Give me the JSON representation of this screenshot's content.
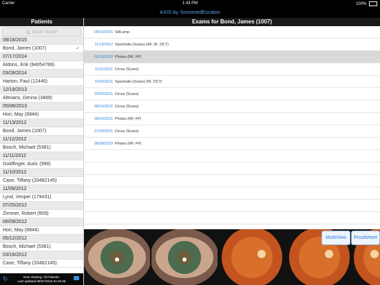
{
  "status_bar": {
    "carrier": "Carrier",
    "time": "1:43 PM",
    "battery": "100%"
  },
  "app": {
    "title": "AXIS by SonomedEscalon"
  },
  "patients_pane": {
    "title": "Patients",
    "search_placeholder": "Smart Search",
    "rows": [
      {
        "date": "09/16/2015",
        "name": "Bond, James (1007)",
        "selected": true
      },
      {
        "date": "07/17/2014",
        "name": "Aldons, Erik (94054789)"
      },
      {
        "date": "03/28/2014",
        "name": "Harton, Paul (12446)"
      },
      {
        "date": "12/19/2013",
        "name": "Altmans, Denna (3489)"
      },
      {
        "date": "05/06/2013",
        "name": "Hori, May (6844)"
      },
      {
        "date": "11/13/2012",
        "name": "Bond, James (1007)"
      },
      {
        "date": "11/12/2012",
        "name": "Bosch, Michael (5381)"
      },
      {
        "date": "11/11/2012",
        "name": "Goldfinger, Auric (998)"
      },
      {
        "date": "11/10/2012",
        "name": "Case, Tiffany (33482145)"
      },
      {
        "date": "11/09/2012",
        "name": "Lynd, Vesper (179431)"
      },
      {
        "date": "07/25/2012",
        "name": "Zimmer, Robert (609)"
      },
      {
        "date": "06/09/2012",
        "name": "Hori, May (6844)"
      },
      {
        "date": "05/12/2012",
        "name": "Bosch, Michael (5381)"
      },
      {
        "date": "03/16/2012",
        "name": "Case, Tiffany (33482145)"
      }
    ],
    "footer_line1": "Now Viewing: All Patients.",
    "footer_line2": "Last updated 08/07/2016 01:40:26"
  },
  "exams_pane": {
    "title": "Exams for Bond, James (1007)",
    "exams": [
      {
        "date": "09/16/2015",
        "type": "SlitLamp"
      },
      {
        "date": "11/13/2012",
        "type": "Spectralis (Scans) (AF, IR, OCT)"
      },
      {
        "date": "02/10/2012",
        "type": "Photos (RF, FP)",
        "selected": true
      },
      {
        "date": "11/01/2011",
        "type": "Cirrus (Scans)"
      },
      {
        "date": "10/25/2011",
        "type": "Spectralis (Scans) (IR, OCT)"
      },
      {
        "date": "09/20/2011",
        "type": "Cirrus (Scans)"
      },
      {
        "date": "08/16/2011",
        "type": "Cirrus (Scans)"
      },
      {
        "date": "08/14/2011",
        "type": "Photos (RF, FP)"
      },
      {
        "date": "07/03/2011",
        "type": "Cirrus (Scans)"
      },
      {
        "date": "08/08/2010",
        "type": "Photos (RF, FP)"
      }
    ]
  },
  "thumbnails": [
    {
      "icon": "external-eye-photo"
    },
    {
      "icon": "external-eye-photo"
    },
    {
      "icon": "fundus-photo"
    },
    {
      "icon": "fundus-photo"
    },
    {
      "icon": "fundus-photo"
    }
  ],
  "buttons": {
    "multiview": "MultiView",
    "proofsheet": "Proofsheet"
  },
  "colors": {
    "accent": "#2d83e0",
    "header": "#1a1a1a",
    "selected_row": "#d9d9d9"
  }
}
